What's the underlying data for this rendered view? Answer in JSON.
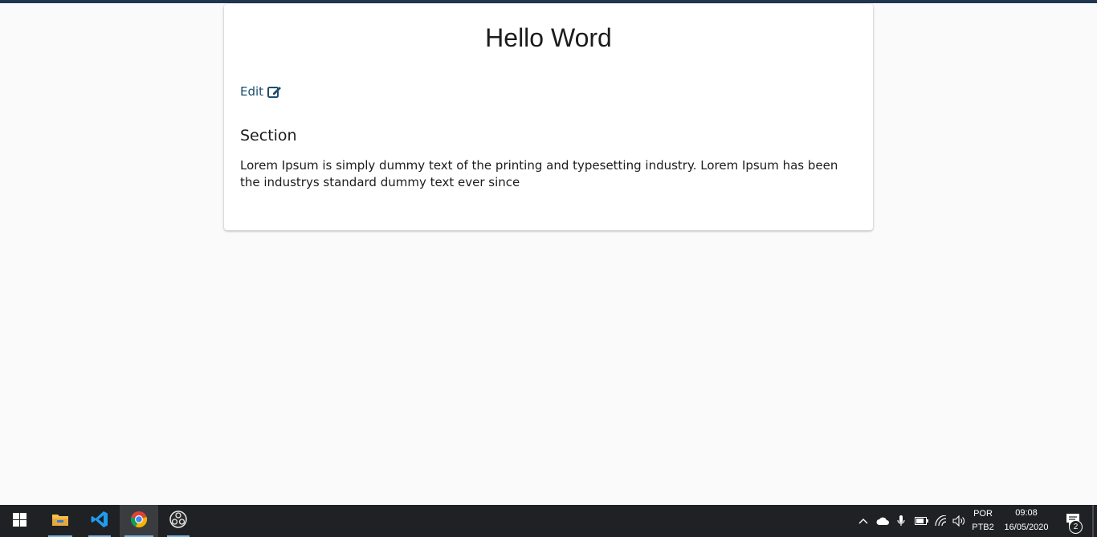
{
  "card": {
    "title": "Hello Word",
    "edit_label": "Edit",
    "section_title": "Section",
    "section_text": "Lorem Ipsum is simply dummy text of the printing and typesetting industry. Lorem Ipsum has been the industrys standard dummy text ever since"
  },
  "colors": {
    "top_strip": "#1f3550",
    "link": "#1e4d70",
    "page_bg": "#fafafa",
    "taskbar_bg": "#202124"
  },
  "taskbar": {
    "apps": [
      {
        "name": "file-explorer",
        "icon": "folder-icon",
        "active": false,
        "open": true
      },
      {
        "name": "visual-studio-code",
        "icon": "vscode-icon",
        "active": false,
        "open": true
      },
      {
        "name": "google-chrome",
        "icon": "chrome-icon",
        "active": true,
        "open": true
      },
      {
        "name": "obs-studio",
        "icon": "obs-icon",
        "active": false,
        "open": true
      }
    ],
    "tray": {
      "language_top": "POR",
      "language_bottom": "PTB2",
      "time": "09:08",
      "date": "16/05/2020",
      "notifications_count": "2"
    }
  }
}
